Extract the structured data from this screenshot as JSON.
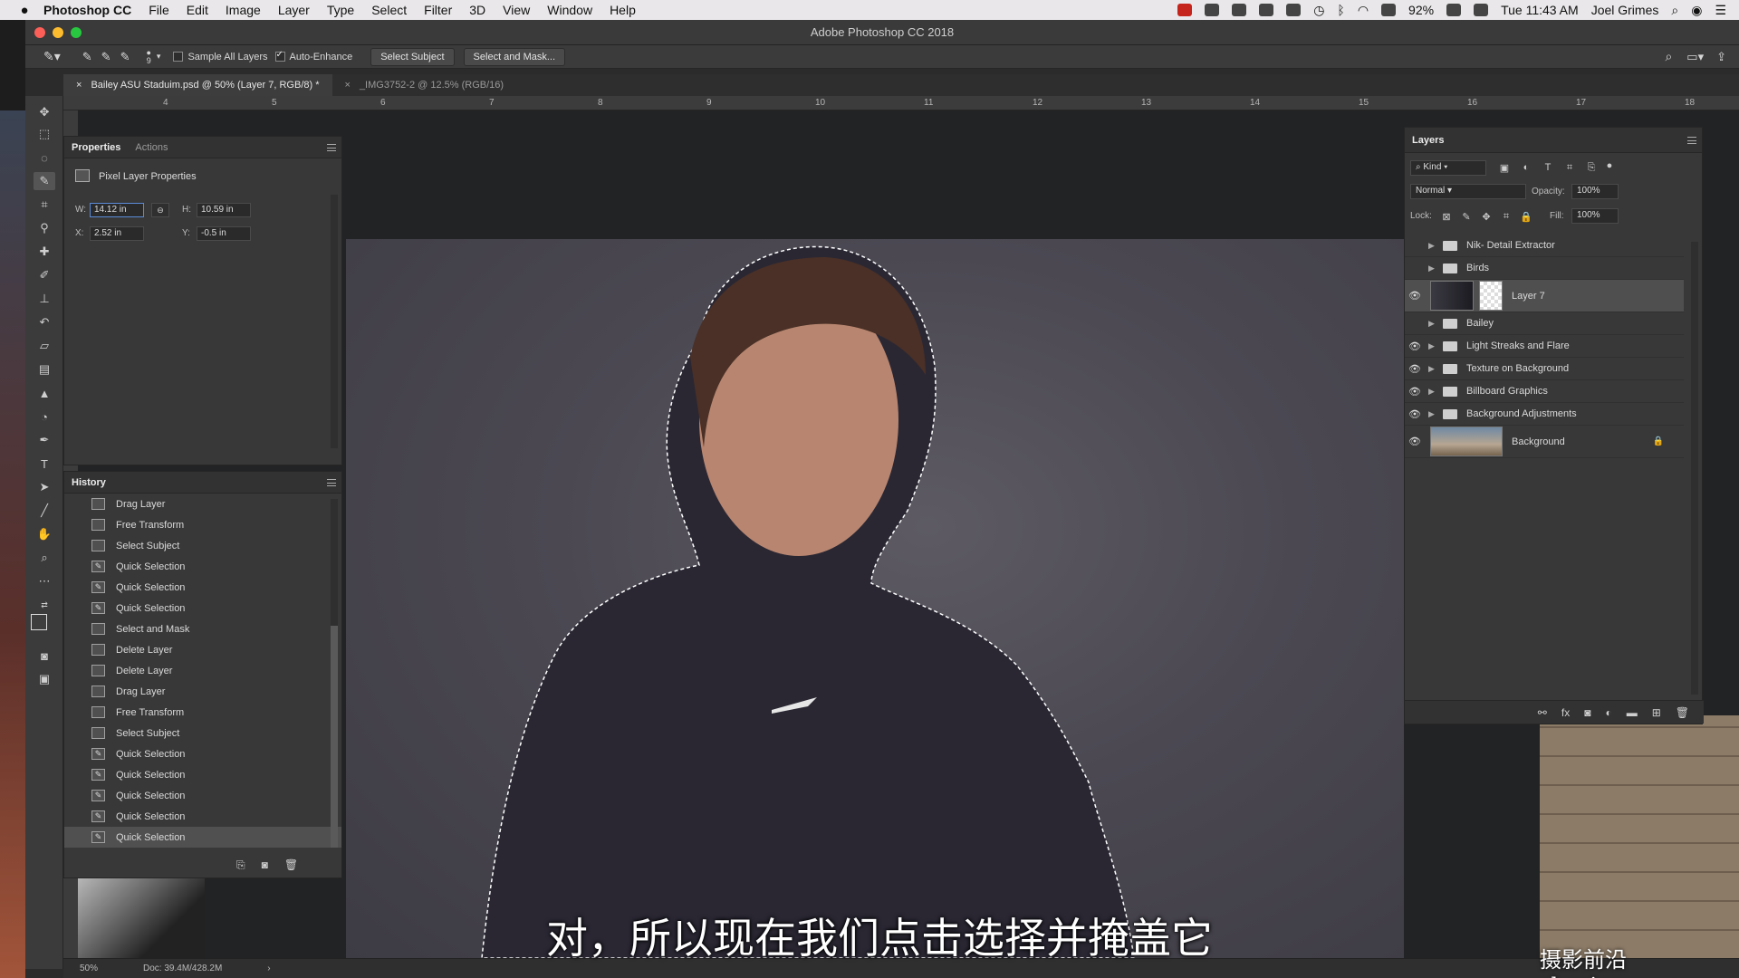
{
  "menubar": {
    "app": "Photoshop CC",
    "items": [
      "File",
      "Edit",
      "Image",
      "Layer",
      "Type",
      "Select",
      "Filter",
      "3D",
      "View",
      "Window",
      "Help"
    ],
    "battery": "92%",
    "clock": "Tue 11:43 AM",
    "user": "Joel Grimes"
  },
  "window": {
    "title": "Adobe Photoshop CC 2018"
  },
  "options": {
    "brush_size": "9",
    "sample_all_layers": "Sample All Layers",
    "auto_enhance": "Auto-Enhance",
    "select_subject": "Select Subject",
    "select_and_mask": "Select and Mask..."
  },
  "doc_tabs": [
    {
      "label": "Bailey ASU Staduim.psd @ 50% (Layer 7, RGB/8) *",
      "active": true
    },
    {
      "label": "_IMG3752-2 @ 12.5% (RGB/16)",
      "active": false
    }
  ],
  "ruler_ticks": [
    "4",
    "5",
    "6",
    "7",
    "8",
    "9",
    "10",
    "11",
    "12",
    "13",
    "14",
    "15",
    "16",
    "17",
    "18"
  ],
  "properties": {
    "tabs": [
      "Properties",
      "Actions"
    ],
    "section": "Pixel Layer Properties",
    "w_label": "W:",
    "w": "14.12 in",
    "h_label": "H:",
    "h": "10.59 in",
    "x_label": "X:",
    "x": "2.52 in",
    "y_label": "Y:",
    "y": "-0.5 in"
  },
  "history": {
    "title": "History",
    "items": [
      {
        "label": "Drag Layer",
        "icon": "doc-icon"
      },
      {
        "label": "Free Transform",
        "icon": "doc-icon"
      },
      {
        "label": "Select Subject",
        "icon": "doc-icon"
      },
      {
        "label": "Quick Selection",
        "icon": "quick-select-icon"
      },
      {
        "label": "Quick Selection",
        "icon": "quick-select-icon"
      },
      {
        "label": "Quick Selection",
        "icon": "quick-select-icon"
      },
      {
        "label": "Select and Mask",
        "icon": "doc-icon"
      },
      {
        "label": "Delete Layer",
        "icon": "doc-icon"
      },
      {
        "label": "Delete Layer",
        "icon": "doc-icon"
      },
      {
        "label": "Drag Layer",
        "icon": "doc-icon"
      },
      {
        "label": "Free Transform",
        "icon": "doc-icon"
      },
      {
        "label": "Select Subject",
        "icon": "doc-icon"
      },
      {
        "label": "Quick Selection",
        "icon": "quick-select-icon"
      },
      {
        "label": "Quick Selection",
        "icon": "quick-select-icon"
      },
      {
        "label": "Quick Selection",
        "icon": "quick-select-icon"
      },
      {
        "label": "Quick Selection",
        "icon": "quick-select-icon"
      },
      {
        "label": "Quick Selection",
        "icon": "quick-select-icon"
      }
    ]
  },
  "layers": {
    "title": "Layers",
    "filter": "Kind",
    "blend_mode": "Normal",
    "opacity_label": "Opacity:",
    "opacity": "100%",
    "lock_label": "Lock:",
    "fill_label": "Fill:",
    "fill": "100%",
    "items": [
      {
        "name": "Nik- Detail Extractor",
        "type": "group",
        "visible": false
      },
      {
        "name": "Birds",
        "type": "group",
        "visible": false
      },
      {
        "name": "Layer 7",
        "type": "pixel",
        "visible": true,
        "selected": true
      },
      {
        "name": "Bailey",
        "type": "group",
        "visible": false
      },
      {
        "name": "Light Streaks and Flare",
        "type": "group",
        "visible": true
      },
      {
        "name": "Texture on Background",
        "type": "group",
        "visible": true
      },
      {
        "name": "Billboard Graphics",
        "type": "group",
        "visible": true
      },
      {
        "name": "Background Adjustments",
        "type": "group",
        "visible": true
      },
      {
        "name": "Background",
        "type": "background",
        "visible": true,
        "locked": true
      }
    ]
  },
  "status": {
    "zoom": "50%",
    "doc": "Doc: 39.4M/428.2M"
  },
  "subtitle": "对，所以现在我们点击选择并掩盖它",
  "watermark": "摄影前沿 sheyingzyz.com"
}
